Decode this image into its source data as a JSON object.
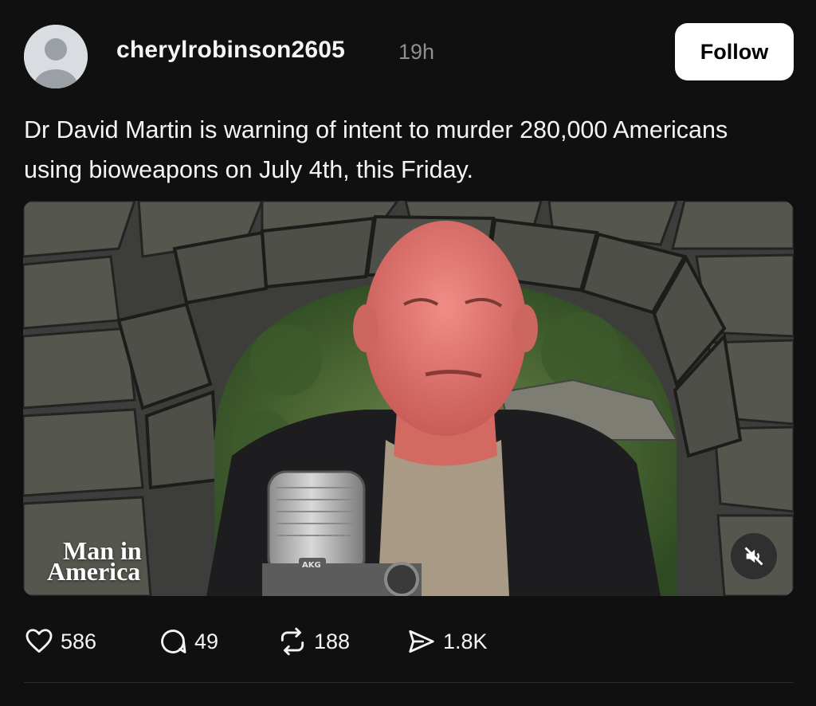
{
  "post": {
    "username": "cherylrobinson2605",
    "timestamp": "19h",
    "follow_label": "Follow",
    "text": "Dr David Martin is warning of intent to murder 280,000 Americans using bioweapons on July 4th, this Friday."
  },
  "video": {
    "watermark_line1": "Man in",
    "watermark_line2": "America",
    "microphone_brand": "AKG",
    "muted": true
  },
  "actions": {
    "likes": "586",
    "replies": "49",
    "reposts": "188",
    "shares": "1.8K"
  },
  "icons": {
    "avatar": "default-avatar-icon",
    "like": "heart-icon",
    "reply": "comment-bubble-icon",
    "repost": "repost-icon",
    "share": "send-icon",
    "mute": "speaker-muted-icon"
  }
}
